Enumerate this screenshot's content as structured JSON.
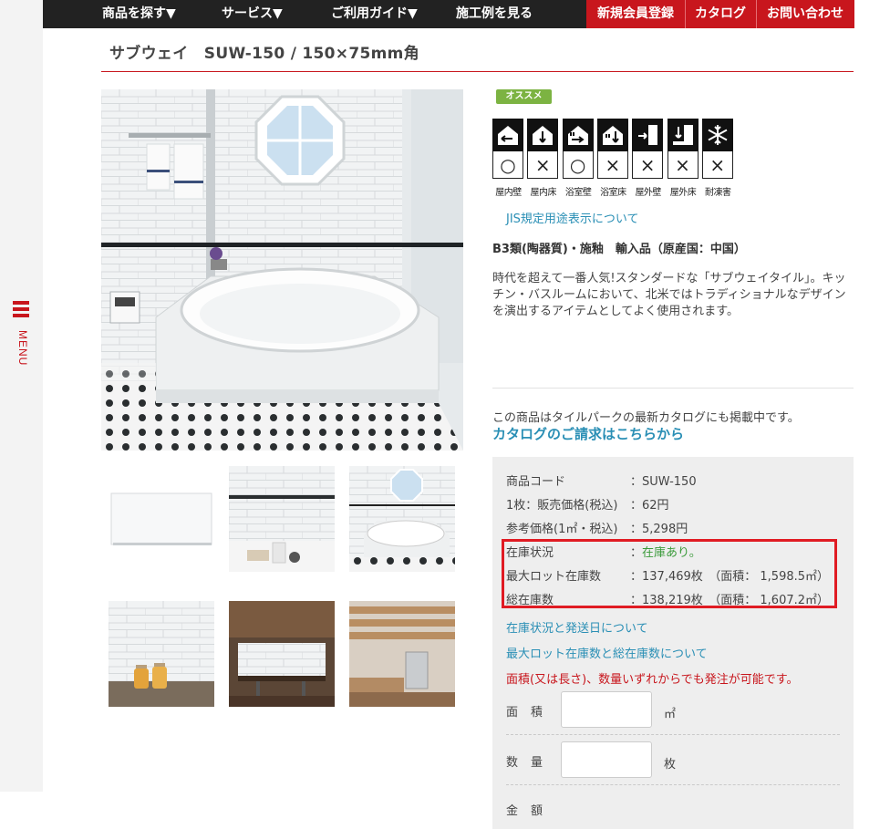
{
  "side_menu": {
    "label": "MENU"
  },
  "nav": {
    "items": [
      "商品を探す▼",
      "サービス▼",
      "ご利用ガイド▼",
      "施工例を見る"
    ],
    "red_items": [
      "新規会員登録",
      "カタログ",
      "お問い合わせ"
    ]
  },
  "product": {
    "title": "サブウェイ　SUW-150 / 150×75mm角",
    "badge": "オススメ",
    "uses": [
      {
        "label": "屋内壁",
        "mark": "○",
        "icon": "indoor-wall-icon"
      },
      {
        "label": "屋内床",
        "mark": "×",
        "icon": "indoor-floor-icon"
      },
      {
        "label": "浴室壁",
        "mark": "○",
        "icon": "bath-wall-icon"
      },
      {
        "label": "浴室床",
        "mark": "×",
        "icon": "bath-floor-icon"
      },
      {
        "label": "屋外壁",
        "mark": "×",
        "icon": "outdoor-wall-icon"
      },
      {
        "label": "屋外床",
        "mark": "×",
        "icon": "outdoor-floor-icon"
      },
      {
        "label": "耐凍害",
        "mark": "×",
        "icon": "frost-resistance-icon"
      }
    ],
    "jis_link": "JIS規定用途表示について",
    "spec": "B3類(陶器質)・施釉　輸入品（原産国：中国）",
    "description": "時代を超えて一番人気!スタンダードな「サブウェイタイル」。キッチン・バスルームにおいて、北米ではトラディショナルなデザインを演出するアイテムとしてよく使用されます。",
    "catalog_note": "この商品はタイルパークの最新カタログにも掲載中です。",
    "catalog_link": "カタログのご請求はこちらから"
  },
  "info": {
    "rows": [
      {
        "key": "商品コード",
        "value": "：SUW-150"
      },
      {
        "key": "1枚：販売価格(税込)",
        "value": "：62円"
      },
      {
        "key": "参考価格(1㎡・税込)",
        "value": "：5,298円"
      },
      {
        "key": "在庫状況",
        "value_prefix": "：",
        "value": "在庫あり。"
      },
      {
        "key": "最大ロット在庫数",
        "value": "：137,469枚　（面積： 1,598.5㎡）"
      },
      {
        "key": "総在庫数",
        "value": "：138,219枚　（面積： 1,607.2㎡）"
      }
    ],
    "link_stock": "在庫状況と発送日について",
    "link_lot": "最大ロット在庫数と総在庫数について",
    "order_note": "面積(又は長さ)、数量いずれからでも発注が可能です。",
    "area_label": "面積",
    "area_unit": "㎡",
    "area_value": "",
    "qty_label": "数量",
    "qty_unit": "枚",
    "qty_value": "",
    "amount_label": "金額"
  },
  "colors": {
    "brand_red": "#c8161d",
    "link_blue": "#2a8fb5",
    "badge_green": "#7cb342"
  }
}
